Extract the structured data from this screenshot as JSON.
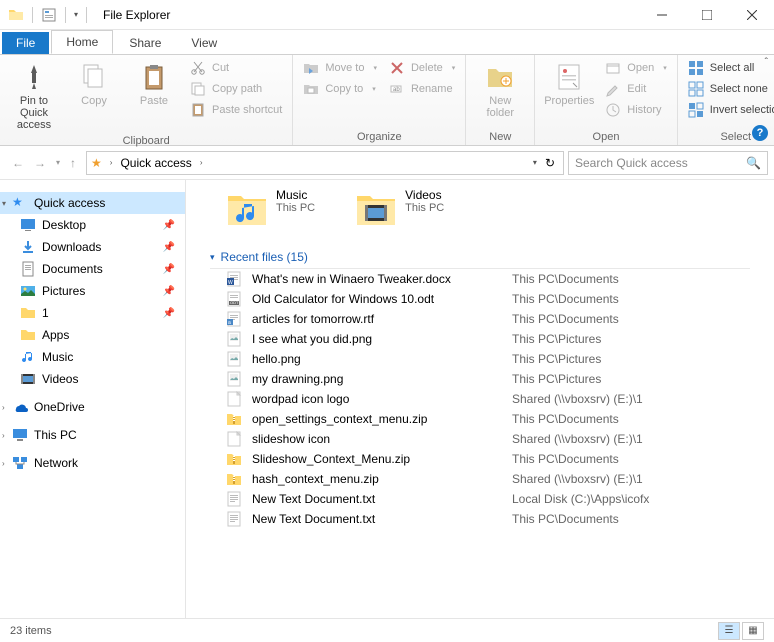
{
  "window": {
    "title": "File Explorer"
  },
  "tabs": {
    "file": "File",
    "home": "Home",
    "share": "Share",
    "view": "View"
  },
  "ribbon": {
    "clipboard": {
      "label": "Clipboard",
      "pin": "Pin to Quick access",
      "copy": "Copy",
      "paste": "Paste",
      "cut": "Cut",
      "copypath": "Copy path",
      "pasteshortcut": "Paste shortcut"
    },
    "organize": {
      "label": "Organize",
      "moveto": "Move to",
      "copyto": "Copy to",
      "delete": "Delete",
      "rename": "Rename"
    },
    "new": {
      "label": "New",
      "newfolder": "New folder"
    },
    "open": {
      "label": "Open",
      "properties": "Properties",
      "open": "Open",
      "edit": "Edit",
      "history": "History"
    },
    "select": {
      "label": "Select",
      "selectall": "Select all",
      "selectnone": "Select none",
      "invert": "Invert selection"
    }
  },
  "address": {
    "crumb": "Quick access"
  },
  "search": {
    "placeholder": "Search Quick access"
  },
  "sidebar": {
    "quickaccess": "Quick access",
    "desktop": "Desktop",
    "downloads": "Downloads",
    "documents": "Documents",
    "pictures": "Pictures",
    "one": "1",
    "apps": "Apps",
    "music": "Music",
    "videos": "Videos",
    "onedrive": "OneDrive",
    "thispc": "This PC",
    "network": "Network"
  },
  "folders": [
    {
      "name": "Music",
      "sub": "This PC"
    },
    {
      "name": "Videos",
      "sub": "This PC"
    }
  ],
  "recent": {
    "header": "Recent files (15)",
    "files": [
      {
        "name": "What's new in Winaero Tweaker.docx",
        "loc": "This PC\\Documents",
        "type": "docx"
      },
      {
        "name": "Old Calculator for Windows 10.odt",
        "loc": "This PC\\Documents",
        "type": "odt"
      },
      {
        "name": "articles for tomorrow.rtf",
        "loc": "This PC\\Documents",
        "type": "rtf"
      },
      {
        "name": "I see what you did.png",
        "loc": "This PC\\Pictures",
        "type": "png"
      },
      {
        "name": "hello.png",
        "loc": "This PC\\Pictures",
        "type": "png"
      },
      {
        "name": "my drawning.png",
        "loc": "This PC\\Pictures",
        "type": "png"
      },
      {
        "name": "wordpad icon logo",
        "loc": "Shared (\\\\vboxsrv) (E:)\\1",
        "type": "file"
      },
      {
        "name": "open_settings_context_menu.zip",
        "loc": "This PC\\Documents",
        "type": "zip"
      },
      {
        "name": "slideshow icon",
        "loc": "Shared (\\\\vboxsrv) (E:)\\1",
        "type": "file"
      },
      {
        "name": "Slideshow_Context_Menu.zip",
        "loc": "This PC\\Documents",
        "type": "zip"
      },
      {
        "name": "hash_context_menu.zip",
        "loc": "Shared (\\\\vboxsrv) (E:)\\1",
        "type": "zip"
      },
      {
        "name": "New Text Document.txt",
        "loc": "Local Disk (C:)\\Apps\\icofx",
        "type": "txt"
      },
      {
        "name": "New Text Document.txt",
        "loc": "This PC\\Documents",
        "type": "txt"
      }
    ]
  },
  "status": {
    "text": "23 items"
  }
}
